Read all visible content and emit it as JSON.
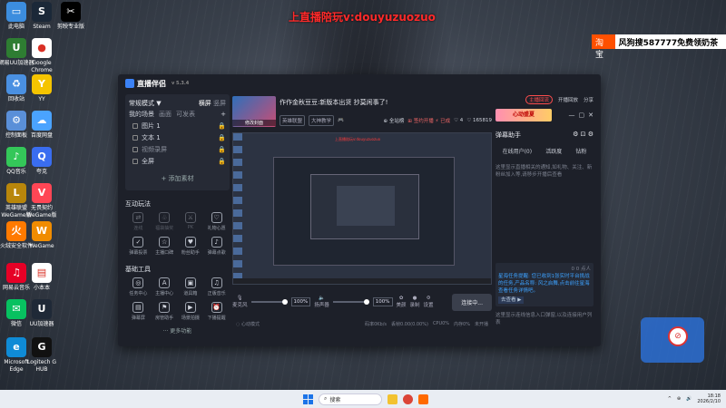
{
  "overlay_title": "上直播陪玩v:douyuzuozuo",
  "ad": {
    "tag": "淘宝",
    "text": "风狗搜587777免费领奶茶"
  },
  "desktop_icons": [
    {
      "label": "此电脑",
      "color": "#3c8dde",
      "glyph": "▭"
    },
    {
      "label": "Steam",
      "color": "#1b2838",
      "glyph": "S"
    },
    {
      "label": "剪映专业版",
      "color": "#000000",
      "glyph": "✂"
    },
    {
      "label": "網易UU加速器",
      "color": "#2e7d32",
      "glyph": "U"
    },
    {
      "label": "Google Chrome",
      "color": "#ffffff",
      "glyph": "●"
    },
    {
      "label": "回收站",
      "color": "#4a90e2",
      "glyph": "♻"
    },
    {
      "label": "YY",
      "color": "#f5c400",
      "glyph": "Y"
    },
    {
      "label": "控制面板",
      "color": "#5a8fd8",
      "glyph": "⚙"
    },
    {
      "label": "百度网盘",
      "color": "#4aa3ff",
      "glyph": "☁"
    },
    {
      "label": "QQ音乐",
      "color": "#34c759",
      "glyph": "♪"
    },
    {
      "label": "夸克",
      "color": "#3a6df0",
      "glyph": "Q"
    },
    {
      "label": "英雄联盟WeGame版",
      "color": "#b8860b",
      "glyph": "L"
    },
    {
      "label": "无畏契约WeGame版",
      "color": "#ff4655",
      "glyph": "V"
    },
    {
      "label": "火绒安全软件",
      "color": "#ff7a00",
      "glyph": "火"
    },
    {
      "label": "WeGame",
      "color": "#f08c00",
      "glyph": "W"
    },
    {
      "label": "网易云音乐",
      "color": "#e60026",
      "glyph": "♫"
    },
    {
      "label": "小本本",
      "color": "#ffffff",
      "glyph": "▤"
    },
    {
      "label": "微信",
      "color": "#07c160",
      "glyph": "✉"
    },
    {
      "label": "UU加速器",
      "color": "#1f2937",
      "glyph": "U"
    },
    {
      "label": "Microsoft Edge",
      "color": "#0f8bd6",
      "glyph": "e"
    },
    {
      "label": "Logitech G HUB",
      "color": "#111111",
      "glyph": "G"
    }
  ],
  "app": {
    "name": "直播伴侣",
    "version": "v 5.3.4",
    "scene_mode": "常规模式 ▼",
    "scene_mode_tabs": [
      "横屏",
      "竖屏"
    ],
    "scene_header": "我的场景",
    "scene_header_tabs": [
      "画面",
      "可发表"
    ],
    "sources": [
      "图片 1",
      "文本 1",
      "视频录屏",
      "全屏"
    ],
    "add_source": "+ 添加素材",
    "interactive_title": "互动玩法",
    "interactive_tools": [
      {
        "label": "连线",
        "glyph": "⇄",
        "dim": true
      },
      {
        "label": "福袋抽奖",
        "glyph": "♧",
        "dim": true
      },
      {
        "label": "PK",
        "glyph": "⚔",
        "dim": true
      },
      {
        "label": "礼物心愿",
        "glyph": "♡",
        "dim": false
      },
      {
        "label": "弹幕投票",
        "glyph": "✓",
        "dim": false
      },
      {
        "label": "主播口碑",
        "glyph": "☆",
        "dim": false
      },
      {
        "label": "粉丝助手",
        "glyph": "♥",
        "dim": false
      },
      {
        "label": "弹幕点歌",
        "glyph": "♪",
        "dim": false
      }
    ],
    "basic_title": "基础工具",
    "basic_tools": [
      {
        "label": "任务中心",
        "glyph": "◎"
      },
      {
        "label": "主播中心",
        "glyph": "A"
      },
      {
        "label": "道具箱",
        "glyph": "▣"
      },
      {
        "label": "正版音乐",
        "glyph": "♫"
      },
      {
        "label": "弹幕屏",
        "glyph": "▤"
      },
      {
        "label": "房管助手",
        "glyph": "⚑"
      },
      {
        "label": "场景拍摄",
        "glyph": "▶"
      },
      {
        "label": "下播提醒",
        "glyph": "⏰"
      }
    ],
    "more_tools": "··· 更多功能",
    "room": {
      "cover_label": "修改封面",
      "title": "作作金秋豆豆:新版本出货 抄莫闲事了!",
      "tags": [
        "英雄联盟",
        "大神教学",
        "🎮"
      ],
      "fans": "⊕ 全站榜",
      "fan_club": "⊞ 签约开播 ⚡ 已成",
      "likes": "♡ 4",
      "viewers": "♡ 165819"
    },
    "top_links": {
      "start": "主播回流",
      "open": "开播回放",
      "share": "分享"
    },
    "preview_red_text": "上直播陪玩v:douyuzuozuo",
    "mic_label": "麦克风",
    "mic_pct": "100%",
    "spk_label": "扬声器",
    "spk_pct": "100%",
    "ctrl_icons": [
      {
        "label": "美颜",
        "glyph": "✿"
      },
      {
        "label": "录制",
        "glyph": "●"
      },
      {
        "label": "设置",
        "glyph": "⚙"
      }
    ],
    "start_button": "连接中...",
    "status_left": "◌ 心动模式",
    "status_items": [
      "码率0Kb/s",
      "丢帧0.00(0.00%)",
      "CPU0%",
      "内存0%",
      "未开播"
    ],
    "right": {
      "banner": "心动盛夏",
      "helper_title": "弹幕助手",
      "tabs": [
        "在线用户(0)",
        "活跃度",
        "钻粉"
      ],
      "tip": "这里显示直播相关的通知,如礼物、关注、新粉丝加入等,请移步开播后查看",
      "notice_count": "0 0 点人",
      "notice": "星海任务提醒: 您已收到1张实时平台挑战的任务,产品名称: 风之启舞,点击前往星海查看任务详情吧。",
      "notice_go": "去查看 ▶",
      "bottom_tip": "这里显示连线信息入口弹窗,以及连接用户列表"
    }
  },
  "taskbar": {
    "search": "搜索",
    "time": "18:18",
    "date": "2026/2/10"
  }
}
